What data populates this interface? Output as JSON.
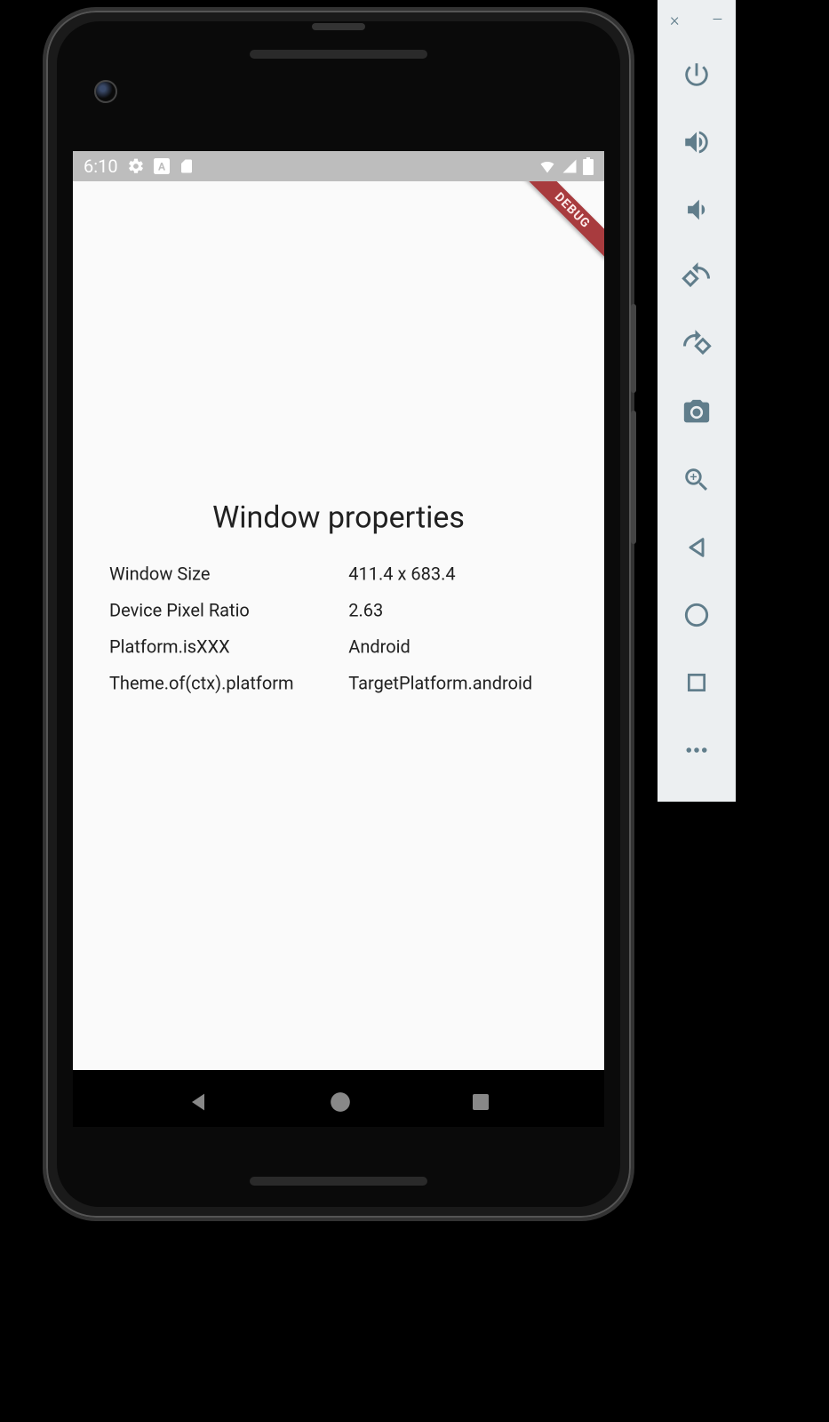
{
  "statusBar": {
    "time": "6:10"
  },
  "debugBanner": "DEBUG",
  "app": {
    "title": "Window properties",
    "rows": [
      {
        "label": "Window Size",
        "value": "411.4 x 683.4"
      },
      {
        "label": "Device Pixel Ratio",
        "value": "2.63"
      },
      {
        "label": "Platform.isXXX",
        "value": "Android"
      },
      {
        "label": "Theme.of(ctx).platform",
        "value": "TargetPlatform.android"
      }
    ]
  },
  "emulatorToolbar": {
    "close": "×",
    "minimize": "–",
    "buttons": [
      "power",
      "volume-up",
      "volume-down",
      "rotate-left",
      "rotate-right",
      "screenshot",
      "zoom",
      "back",
      "home",
      "overview",
      "more"
    ]
  }
}
